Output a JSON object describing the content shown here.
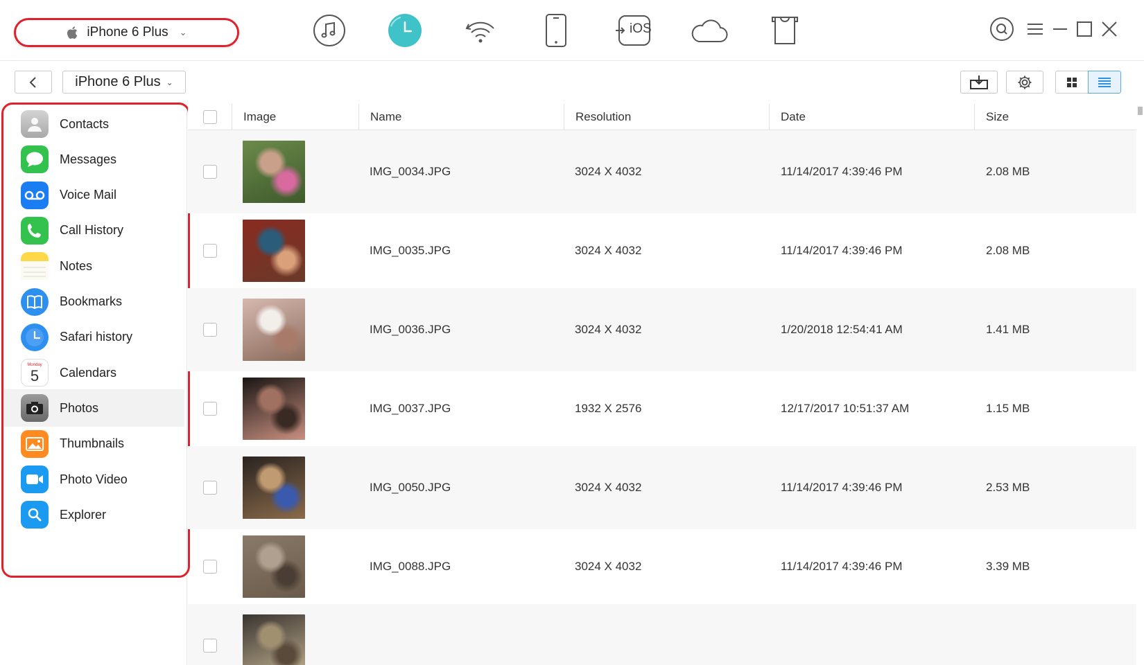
{
  "device": {
    "name": "iPhone 6 Plus"
  },
  "toolbar": {
    "tools": [
      {
        "name": "music-icon"
      },
      {
        "name": "backup-clock-icon",
        "active": true
      },
      {
        "name": "wifi-sync-icon"
      },
      {
        "name": "phone-icon"
      },
      {
        "name": "to-ios-icon",
        "label": "iOS"
      },
      {
        "name": "cloud-icon"
      },
      {
        "name": "tshirt-icon"
      }
    ]
  },
  "subbar": {
    "breadcrumb": "iPhone 6 Plus"
  },
  "sidebar": {
    "items": [
      {
        "label": "Contacts",
        "icon": "contacts-icon",
        "color": "#b8b8b8"
      },
      {
        "label": "Messages",
        "icon": "messages-icon",
        "color": "#32c24d"
      },
      {
        "label": "Voice Mail",
        "icon": "voicemail-icon",
        "color": "#1b7df2"
      },
      {
        "label": "Call History",
        "icon": "call-history-icon",
        "color": "#32c24d"
      },
      {
        "label": "Notes",
        "icon": "notes-icon",
        "color": "#ffd426"
      },
      {
        "label": "Bookmarks",
        "icon": "bookmarks-icon",
        "color": "#2d8ff0"
      },
      {
        "label": "Safari history",
        "icon": "safari-history-icon",
        "color": "#2d8ff0"
      },
      {
        "label": "Calendars",
        "icon": "calendar-icon",
        "color": "#ffffff",
        "day": "5",
        "weekday": "Monday"
      },
      {
        "label": "Photos",
        "icon": "camera-icon",
        "color": "#555555",
        "active": true
      },
      {
        "label": "Thumbnails",
        "icon": "thumbnails-icon",
        "color": "#ff8a1f"
      },
      {
        "label": "Photo Video",
        "icon": "video-icon",
        "color": "#1b9af2"
      },
      {
        "label": "Explorer",
        "icon": "explorer-icon",
        "color": "#1b9af2"
      }
    ]
  },
  "table": {
    "columns": [
      "Image",
      "Name",
      "Resolution",
      "Date",
      "Size"
    ],
    "rows": [
      {
        "name": "IMG_0034.JPG",
        "resolution": "3024 X 4032",
        "date": "11/14/2017 4:39:46 PM",
        "size": "2.08 MB",
        "palette": [
          "#6b8a4a",
          "#c9a08a",
          "#d86aa0",
          "#3e5a2c"
        ]
      },
      {
        "name": "IMG_0035.JPG",
        "resolution": "3024 X 4032",
        "date": "11/14/2017 4:39:46 PM",
        "size": "2.08 MB",
        "palette": [
          "#8a2a20",
          "#2b5c7a",
          "#d9a07a",
          "#6a3a2a"
        ]
      },
      {
        "name": "IMG_0036.JPG",
        "resolution": "3024 X 4032",
        "date": "1/20/2018 12:54:41 AM",
        "size": "1.41 MB",
        "palette": [
          "#d6b8b0",
          "#f2eeea",
          "#a87a6a",
          "#8a6a5a"
        ]
      },
      {
        "name": "IMG_0037.JPG",
        "resolution": "1932 X 2576",
        "date": "12/17/2017 10:51:37 AM",
        "size": "1.15 MB",
        "palette": [
          "#1a1614",
          "#a07060",
          "#3a2a24",
          "#c89080"
        ]
      },
      {
        "name": "IMG_0050.JPG",
        "resolution": "3024 X 4032",
        "date": "11/14/2017 4:39:46 PM",
        "size": "2.53 MB",
        "palette": [
          "#2a2420",
          "#c09a70",
          "#3a5ab0",
          "#8a6a4a"
        ]
      },
      {
        "name": "IMG_0088.JPG",
        "resolution": "3024 X 4032",
        "date": "11/14/2017 4:39:46 PM",
        "size": "3.39 MB",
        "palette": [
          "#8a7a6a",
          "#b0a090",
          "#4a3e34",
          "#6a5a4a"
        ]
      },
      {
        "name": "",
        "resolution": "",
        "date": "",
        "size": "",
        "palette": [
          "#3a3430",
          "#a09070",
          "#5a4a3a",
          "#c0b090"
        ]
      }
    ]
  }
}
